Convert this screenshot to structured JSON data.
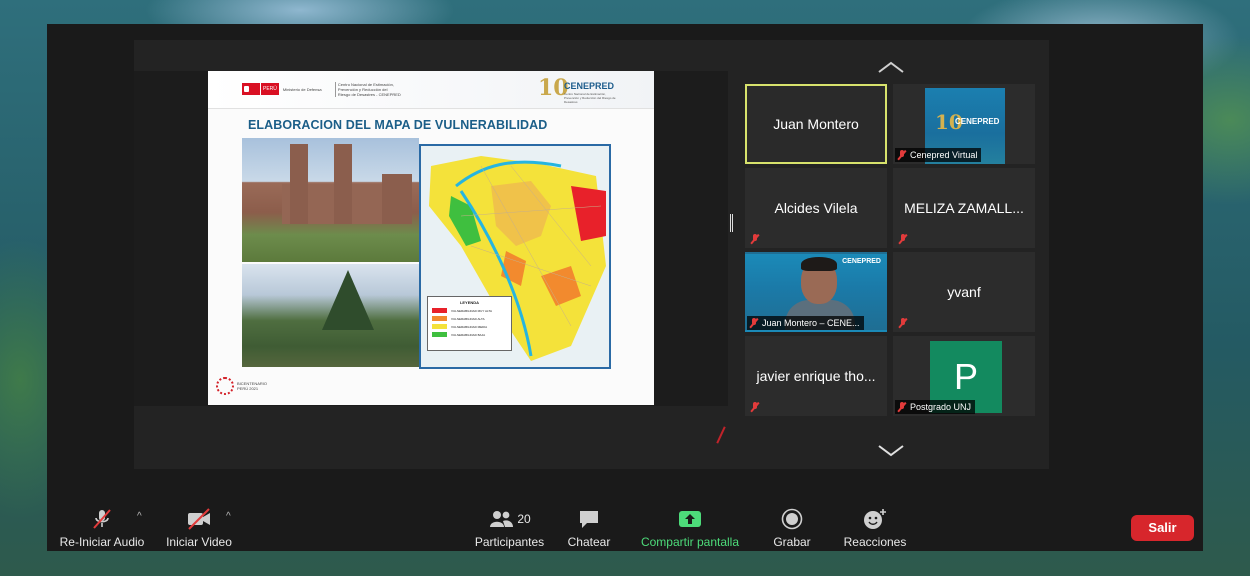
{
  "slide": {
    "gov_label": "PERÚ",
    "gov_ministry": "Ministerio de Defensa",
    "gov_center": "Centro Nacional de Estimación, Prevención y Reducción del Riesgo de Desastres - CENEPRED",
    "logo_number": "10",
    "logo_brand": "CENEPRED",
    "logo_sub": "Centro Nacional de Estimación, Prevención y Reducción del Riesgo de Desastres",
    "title": "ELABORACION DEL MAPA DE VULNERABILIDAD",
    "legend_title": "LEYENDA",
    "legend": [
      {
        "label": "VULNERABILIDAD MUY ALTA",
        "color": "#e8212a"
      },
      {
        "label": "VULNERABILIDAD ALTA",
        "color": "#f28a2e"
      },
      {
        "label": "VULNERABILIDAD MEDIA",
        "color": "#f4e23a"
      },
      {
        "label": "VULNERABILIDAD BAJA",
        "color": "#3fbf3f"
      }
    ],
    "bicentenario": "BICENTENARIO PERÚ 2021"
  },
  "gallery": {
    "tiles": [
      {
        "name": "Juan Montero",
        "active": true
      },
      {
        "label": "Cenepred Virtual",
        "logo_brand": "CENEPRED",
        "logo_number": "10"
      },
      {
        "name": "Alcides Vilela"
      },
      {
        "name": "MELIZA ZAMALL..."
      },
      {
        "label": "Juan Montero – CENE...",
        "logo_brand": "CENEPRED"
      },
      {
        "name": "yvanf"
      },
      {
        "name": "javier enrique tho..."
      },
      {
        "label": "Postgrado UNJ",
        "avatar_letter": "P"
      }
    ]
  },
  "toolbar": {
    "audio_label": "Re-Iniciar Audio",
    "video_label": "Iniciar Video",
    "participants_label": "Participantes",
    "participants_count": "20",
    "chat_label": "Chatear",
    "share_label": "Compartir pantalla",
    "record_label": "Grabar",
    "reactions_label": "Reacciones",
    "leave_label": "Salir"
  },
  "colors": {
    "share_green": "#4ddb7a",
    "leave_red": "#d7262c",
    "active_speaker": "#d7e26c",
    "avatar_green": "#138a5f"
  }
}
